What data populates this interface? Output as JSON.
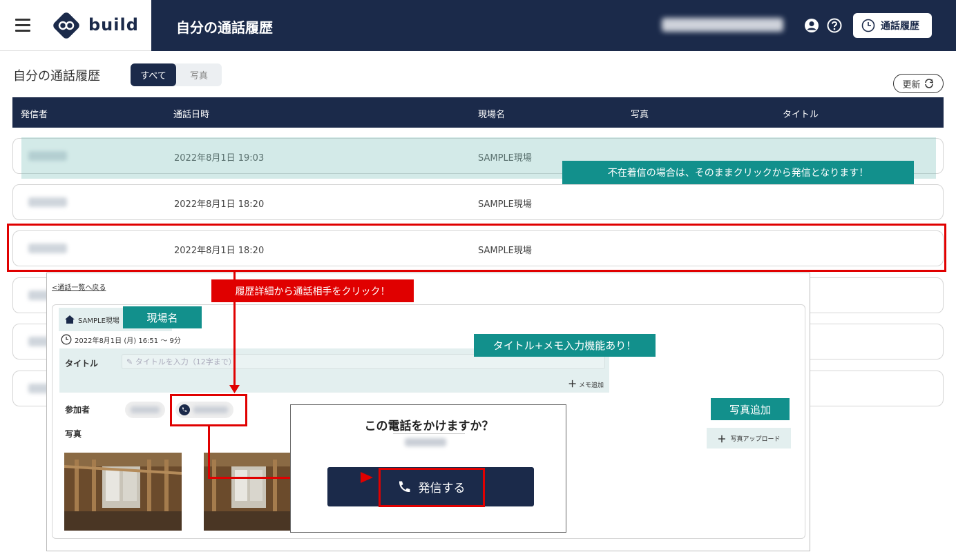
{
  "app": {
    "logo_text": "build",
    "page_heading": "自分の通話履歴"
  },
  "header": {
    "history_button_label": "通話履歴"
  },
  "toolbar": {
    "subtitle": "自分の通話履歴",
    "filter_all": "すべて",
    "filter_photo": "写真",
    "refresh_label": "更新"
  },
  "table": {
    "columns": [
      "発信者",
      "通話日時",
      "現場名",
      "写真",
      "タイトル"
    ],
    "rows": [
      {
        "date": "2022年8月1日 19:03",
        "site": "SAMPLE現場"
      },
      {
        "date": "2022年8月1日 18:20",
        "site": "SAMPLE現場"
      },
      {
        "date": "2022年8月1日 18:20",
        "site": "SAMPLE現場"
      },
      {
        "date": "",
        "site": ""
      },
      {
        "date": "",
        "site": ""
      },
      {
        "date": "",
        "site": ""
      }
    ]
  },
  "annotations": {
    "missed_call_note": "不在着信の場合は、そのままクリックから発信となります！",
    "click_partner_note": "履歴詳細から通話相手をクリック！",
    "site_name_note": "現場名",
    "title_memo_note": "タイトル+メモ入力機能あり！",
    "photo_add_note": "写真追加"
  },
  "detail": {
    "back_link": "<通話一覧へ戻る",
    "site_tag": "SAMPLE現場",
    "datetime": "2022年8月1日 (月) 16:51 ～ 9分",
    "title_label": "タイトル",
    "title_placeholder": "タイトルを入力（12字まで）",
    "memo_add": "メモ追加",
    "participants_label": "参加者",
    "photo_label": "写真",
    "photo_upload": "写真アップロード"
  },
  "dialog": {
    "question": "この電話をかけますか？",
    "call_button": "発信する"
  },
  "colors": {
    "navy": "#1b2a4a",
    "teal": "#12908c",
    "red": "#e00000"
  }
}
